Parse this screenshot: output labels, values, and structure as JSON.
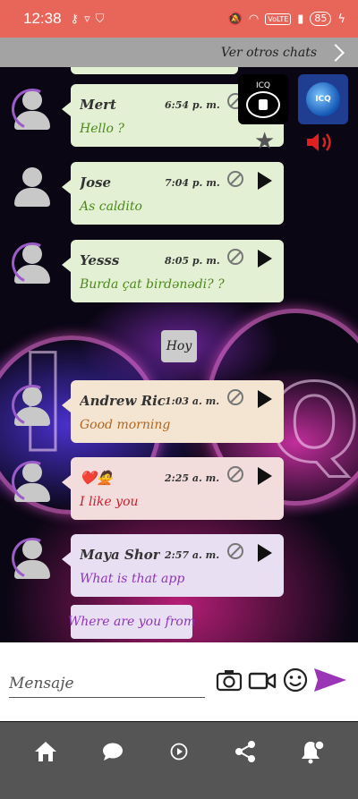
{
  "status_bar": {
    "time": "12:38",
    "network_label": "VoLTE",
    "battery": "85"
  },
  "header": {
    "other_chats_label": "Ver otros chats"
  },
  "lock_tile": {
    "label": "ICQ"
  },
  "globe_tile": {
    "label": "ICQ"
  },
  "messages": [
    {
      "name": "Mert",
      "time": "6:54 p. m.",
      "text": "Hello ?",
      "text_color": "#4b8a1a"
    },
    {
      "name": "Jose",
      "time": "7:04 p. m.",
      "text": "As caldito",
      "text_color": "#4b8a1a"
    },
    {
      "name": "Yesss",
      "time": "8:05 p. m.",
      "text": "Burda çat birdənədi? ?",
      "text_color": "#4b8a1a"
    },
    {
      "name": "Andrew Ric...",
      "time": "1:03 a. m.",
      "text": "Good morning",
      "text_color": "#b5651d"
    },
    {
      "name": "❤️🙅",
      "time": "2:25 a. m.",
      "text": "I like you",
      "text_color": "#c81e2e"
    },
    {
      "name": "Maya Shor",
      "time": "2:57 a. m.",
      "text": "What is that app",
      "text_color": "#8e34b8"
    }
  ],
  "day_label": "Hoy",
  "loose_message": "Where are you from",
  "composer": {
    "placeholder": "Mensaje",
    "send_color": "#9a35b5"
  },
  "icons": {
    "camera": "camera-icon",
    "video": "video-icon",
    "emoji": "emoji-icon",
    "send": "send-icon",
    "home": "home-icon",
    "chat": "chat-bubble-icon",
    "play": "play-circle-icon",
    "share": "share-icon",
    "bell": "bell-settings-icon"
  }
}
